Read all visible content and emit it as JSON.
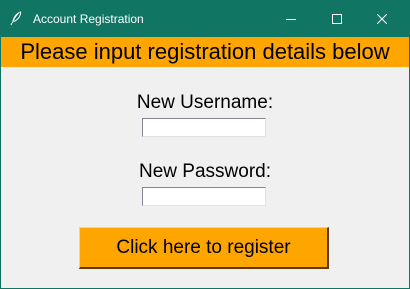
{
  "window": {
    "title": "Account Registration",
    "icon": "feather-icon",
    "controls": [
      "minimize-icon",
      "maximize-icon",
      "close-icon"
    ],
    "titlebar_color": "#117563"
  },
  "banner": {
    "text": "Please input registration details below",
    "color": "#ffa500"
  },
  "form": {
    "username_label": "New Username:",
    "username_value": "",
    "password_label": "New Password:",
    "password_value": ""
  },
  "register_button": {
    "label": "Click here to register",
    "color": "#ffa500"
  }
}
